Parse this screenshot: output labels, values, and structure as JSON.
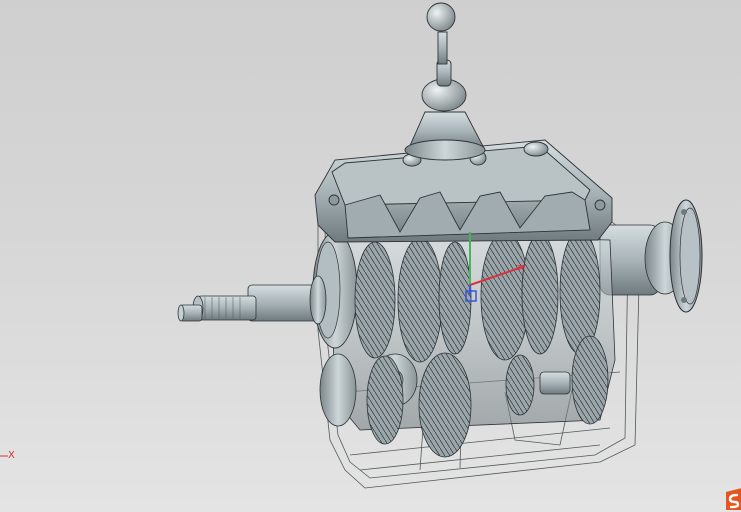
{
  "viewport": {
    "triad": {
      "x_label": "X"
    },
    "model": {
      "subject": "manual-transmission-gearbox",
      "render_mode": "shaded-with-hidden-edges"
    }
  },
  "colors": {
    "background_top": "#cfcfcf",
    "background_bottom": "#e4e4e4",
    "metal": "#a9b4b8",
    "edge": "#2d3336",
    "x_axis": "#d8323a",
    "y_axis": "#46b45a",
    "z_axis": "#3a55d8",
    "brand": "#e8541e"
  }
}
